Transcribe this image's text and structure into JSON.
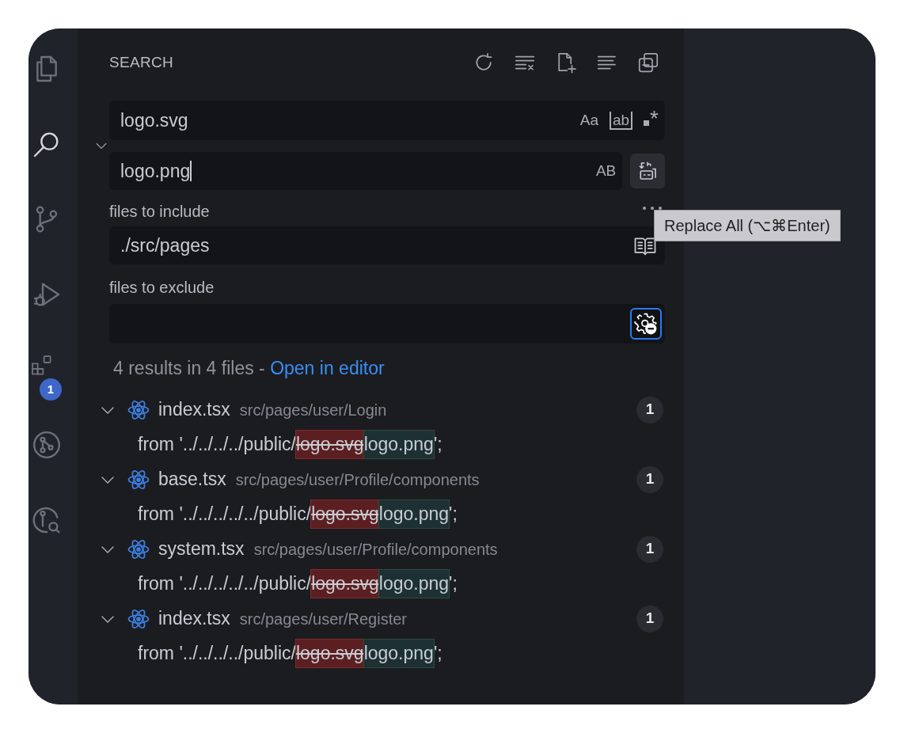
{
  "activity_bar": {
    "items": [
      {
        "selected": false
      },
      {
        "selected": true
      },
      {
        "selected": false
      },
      {
        "selected": false
      },
      {
        "selected": false,
        "badge": "1"
      },
      {
        "selected": false
      },
      {
        "selected": false
      }
    ]
  },
  "sidebar": {
    "title": "SEARCH"
  },
  "search": {
    "expanded": true,
    "value": "logo.svg",
    "options": [
      {
        "kind": "match-case",
        "label": "Aa"
      },
      {
        "kind": "whole-word",
        "label": "ab"
      },
      {
        "kind": "regex",
        "label": "*"
      }
    ]
  },
  "replace": {
    "value": "logo.png",
    "preserve_case_label": "AB",
    "tooltip": "Replace All (⌥⌘Enter)"
  },
  "include": {
    "label": "files to include",
    "value": "./src/pages"
  },
  "exclude": {
    "label": "files to exclude",
    "use_exclude_settings": true
  },
  "results": {
    "summary": "4 results in 4 files - ",
    "link": "Open in editor",
    "files": [
      {
        "name": "index.tsx",
        "path": "src/pages/user/Login",
        "count": "1",
        "expanded": true,
        "matches": [
          {
            "before": "from '../../../../public/",
            "removed": "logo.svg",
            "inserted": "logo.png",
            "after": "';"
          }
        ]
      },
      {
        "name": "base.tsx",
        "path": "src/pages/user/Profile/components",
        "count": "1",
        "expanded": true,
        "matches": [
          {
            "before": "from '../../../../../public/",
            "removed": "logo.svg",
            "inserted": "logo.png",
            "after": "';"
          }
        ]
      },
      {
        "name": "system.tsx",
        "path": "src/pages/user/Profile/components",
        "count": "1",
        "expanded": true,
        "matches": [
          {
            "before": "from '../../../../../public/",
            "removed": "logo.svg",
            "inserted": "logo.png",
            "after": "';"
          }
        ]
      },
      {
        "name": "index.tsx",
        "path": "src/pages/user/Register",
        "count": "1",
        "expanded": true,
        "matches": [
          {
            "before": "from '../../../../public/",
            "removed": "logo.svg",
            "inserted": "logo.png",
            "after": "';"
          }
        ]
      }
    ]
  }
}
